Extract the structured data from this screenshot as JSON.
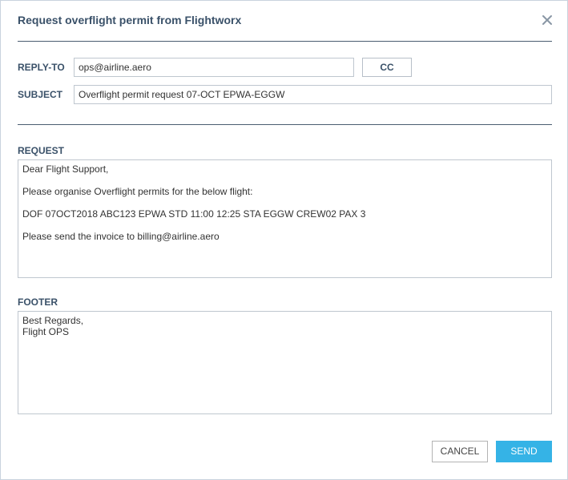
{
  "dialog": {
    "title": "Request overflight permit from Flightworx",
    "close_icon": "close-icon"
  },
  "form": {
    "reply_to_label": "REPLY-TO",
    "reply_to_value": "ops@airline.aero",
    "cc_label": "CC",
    "subject_label": "SUBJECT",
    "subject_value": "Overflight permit request 07-OCT EPWA-EGGW",
    "request_label": "REQUEST",
    "request_lines": [
      "Dear Flight Support,",
      "Please organise Overflight permits for the below flight:",
      "DOF 07OCT2018 ABC123 EPWA STD 11:00 12:25 STA EGGW CREW02 PAX 3",
      "Please send the invoice to billing@airline.aero"
    ],
    "footer_label": "FOOTER",
    "footer_lines": [
      "Best Regards,",
      "Flight OPS"
    ]
  },
  "actions": {
    "cancel_label": "CANCEL",
    "send_label": "SEND"
  },
  "colors": {
    "heading": "#3a5169",
    "divider": "#4a5d70",
    "send_button": "#35b3e6",
    "border": "#bfc7cf"
  }
}
